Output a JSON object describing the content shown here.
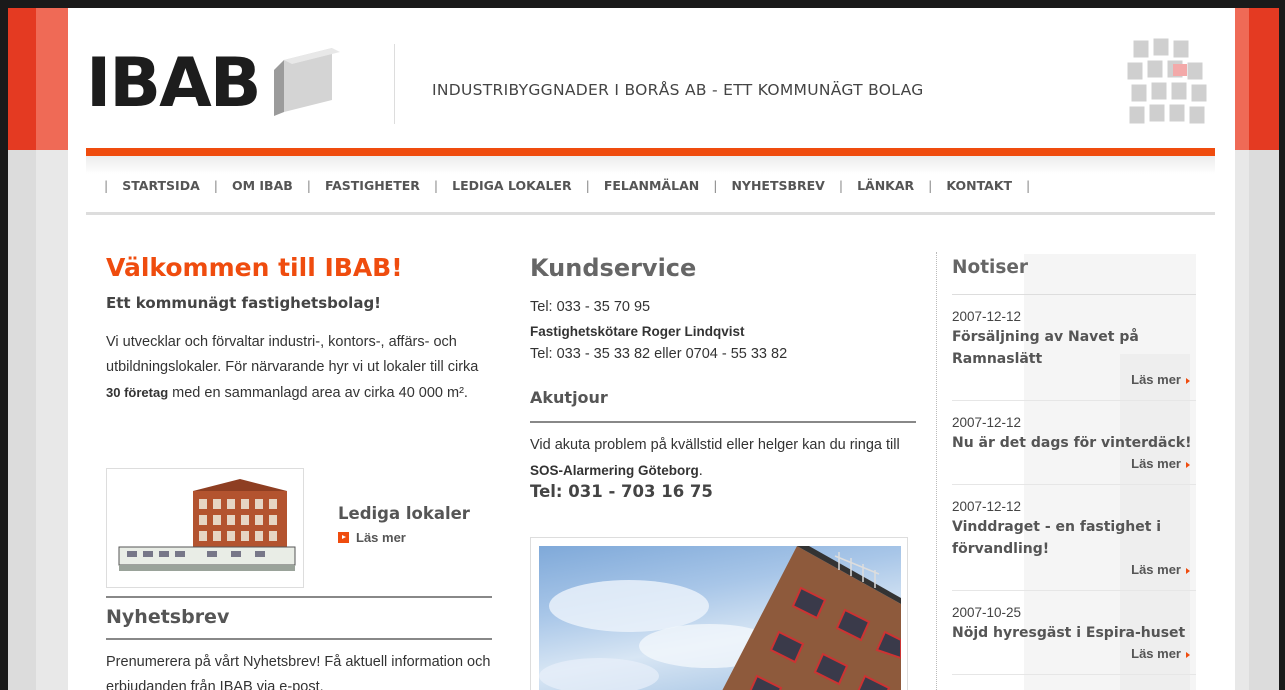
{
  "header": {
    "logo_text": "IBAB",
    "tagline": "INDUSTRIBYGGNADER I BORÅS AB - ETT KOMMUNÄGT BOLAG"
  },
  "nav": {
    "items": [
      {
        "label": "STARTSIDA"
      },
      {
        "label": "OM IBAB"
      },
      {
        "label": "FASTIGHETER"
      },
      {
        "label": "LEDIGA LOKALER"
      },
      {
        "label": "FELANMÄLAN"
      },
      {
        "label": "NYHETSBREV"
      },
      {
        "label": "LÄNKAR"
      },
      {
        "label": "KONTAKT"
      }
    ],
    "separator": "|"
  },
  "welcome": {
    "title": "Välkommen till IBAB!",
    "subtitle": "Ett kommunägt fastighetsbolag!",
    "body_part1": "Vi utvecklar och förvaltar industri-, kontors-, affärs- och utbildningslokaler. För närvarande hyr vi ut lokaler till cirka ",
    "body_bold": "30 företag",
    "body_part2": " med en sammanlagd area av cirka 40 000 m²."
  },
  "lediga": {
    "title": "Lediga lokaler",
    "more": "Läs mer"
  },
  "nyhetsbrev": {
    "title": "Nyhetsbrev",
    "body": "Prenumerera på vårt Nyhetsbrev! Få aktuell information och erbjudanden från IBAB via e-post."
  },
  "kundservice": {
    "title": "Kundservice",
    "tel1": "Tel: 033 - 35 70 95",
    "contact_name": "Fastighetskötare Roger Lindqvist",
    "tel2": "Tel: 033 - 35 33 82 eller 0704 - 55 33 82"
  },
  "akutjour": {
    "title": "Akutjour",
    "body_part1": "Vid akuta problem på kvällstid eller helger kan du ringa till ",
    "body_bold": "SOS-Alarmering Göteborg",
    "body_part2": ".",
    "phone": "Tel: 031 - 703 16 75"
  },
  "notiser": {
    "title": "Notiser",
    "more_label": "Läs mer",
    "items": [
      {
        "date": "2007-12-12",
        "headline": "Försäljning av Navet på Ramnaslätt"
      },
      {
        "date": "2007-12-12",
        "headline": "Nu är det dags för vinterdäck!"
      },
      {
        "date": "2007-12-12",
        "headline": "Vinddraget - en fastighet i förvandling!"
      },
      {
        "date": "2007-10-25",
        "headline": "Nöjd hyresgäst i Espira-huset"
      }
    ]
  },
  "colors": {
    "accent": "#ef4c0e",
    "side_red": "#e43a22"
  }
}
